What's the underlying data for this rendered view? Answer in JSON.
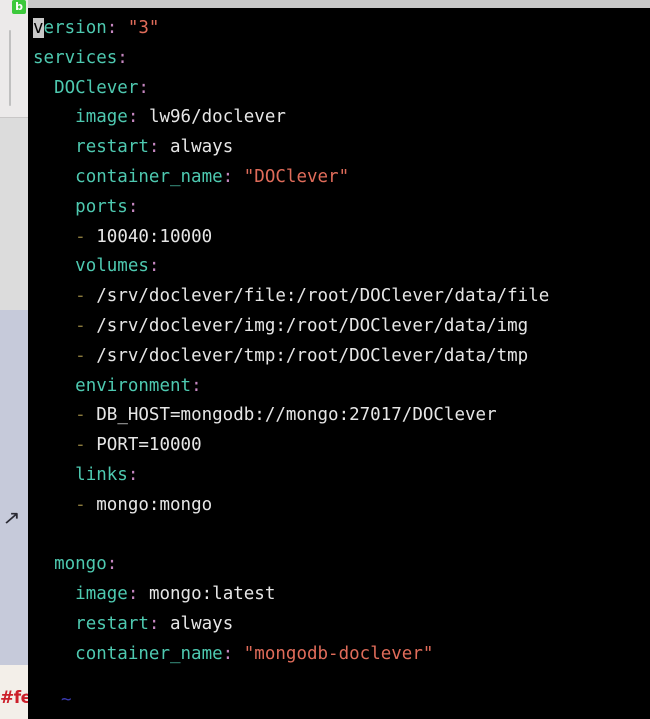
{
  "window": {
    "title_bar_color": "#c8c8c8",
    "terminal_background": "#000000"
  },
  "sidebar": {
    "badge": {
      "name": "green-app-badge",
      "glyph": "b",
      "color": "#3cc93c"
    },
    "arrow_glyph": "↗",
    "partial_red_text": "#fe",
    "bands": [
      {
        "name": "top-gray",
        "color": "#eceaea"
      },
      {
        "name": "white",
        "color": "#dcdcdc"
      },
      {
        "name": "lavender",
        "color": "#c6cada"
      },
      {
        "name": "cream",
        "color": "#f3efe9"
      }
    ]
  },
  "prompt": {
    "symbol": "~"
  },
  "editor": {
    "cursor_char": "v",
    "syntax_colors": {
      "key": "#4ec9b0",
      "colon": "#c586c0",
      "string": "#e06c5a",
      "plain": "#e6e6e6",
      "dash": "#8a7a3c",
      "cursor_bg": "#c8c8c8"
    },
    "lines": [
      {
        "indent": 0,
        "key": "version",
        "value": "\"3\"",
        "value_type": "string",
        "cursor_on_first_char": true
      },
      {
        "indent": 0,
        "key": "services",
        "value": "",
        "value_type": "none"
      },
      {
        "indent": 2,
        "key": "DOClever",
        "value": "",
        "value_type": "none"
      },
      {
        "indent": 4,
        "key": "image",
        "value": "lw96/doclever",
        "value_type": "plain"
      },
      {
        "indent": 4,
        "key": "restart",
        "value": "always",
        "value_type": "plain"
      },
      {
        "indent": 4,
        "key": "container_name",
        "value": "\"DOClever\"",
        "value_type": "string"
      },
      {
        "indent": 4,
        "key": "ports",
        "value": "",
        "value_type": "none"
      },
      {
        "indent": 4,
        "dash": true,
        "value": "10040:10000",
        "value_type": "plain"
      },
      {
        "indent": 4,
        "key": "volumes",
        "value": "",
        "value_type": "none"
      },
      {
        "indent": 4,
        "dash": true,
        "value": "/srv/doclever/file:/root/DOClever/data/file",
        "value_type": "plain"
      },
      {
        "indent": 4,
        "dash": true,
        "value": "/srv/doclever/img:/root/DOClever/data/img",
        "value_type": "plain"
      },
      {
        "indent": 4,
        "dash": true,
        "value": "/srv/doclever/tmp:/root/DOClever/data/tmp",
        "value_type": "plain"
      },
      {
        "indent": 4,
        "key": "environment",
        "value": "",
        "value_type": "none"
      },
      {
        "indent": 4,
        "dash": true,
        "value": "DB_HOST=mongodb://mongo:27017/DOClever",
        "value_type": "plain"
      },
      {
        "indent": 4,
        "dash": true,
        "value": "PORT=10000",
        "value_type": "plain"
      },
      {
        "indent": 4,
        "key": "links",
        "value": "",
        "value_type": "none"
      },
      {
        "indent": 4,
        "dash": true,
        "value": "mongo:mongo",
        "value_type": "plain"
      },
      {
        "indent": 0,
        "blank": true
      },
      {
        "indent": 2,
        "key": "mongo",
        "value": "",
        "value_type": "none"
      },
      {
        "indent": 4,
        "key": "image",
        "value": "mongo:latest",
        "value_type": "plain"
      },
      {
        "indent": 4,
        "key": "restart",
        "value": "always",
        "value_type": "plain"
      },
      {
        "indent": 4,
        "key": "container_name",
        "value": "\"mongodb-doclever\"",
        "value_type": "string"
      }
    ]
  }
}
